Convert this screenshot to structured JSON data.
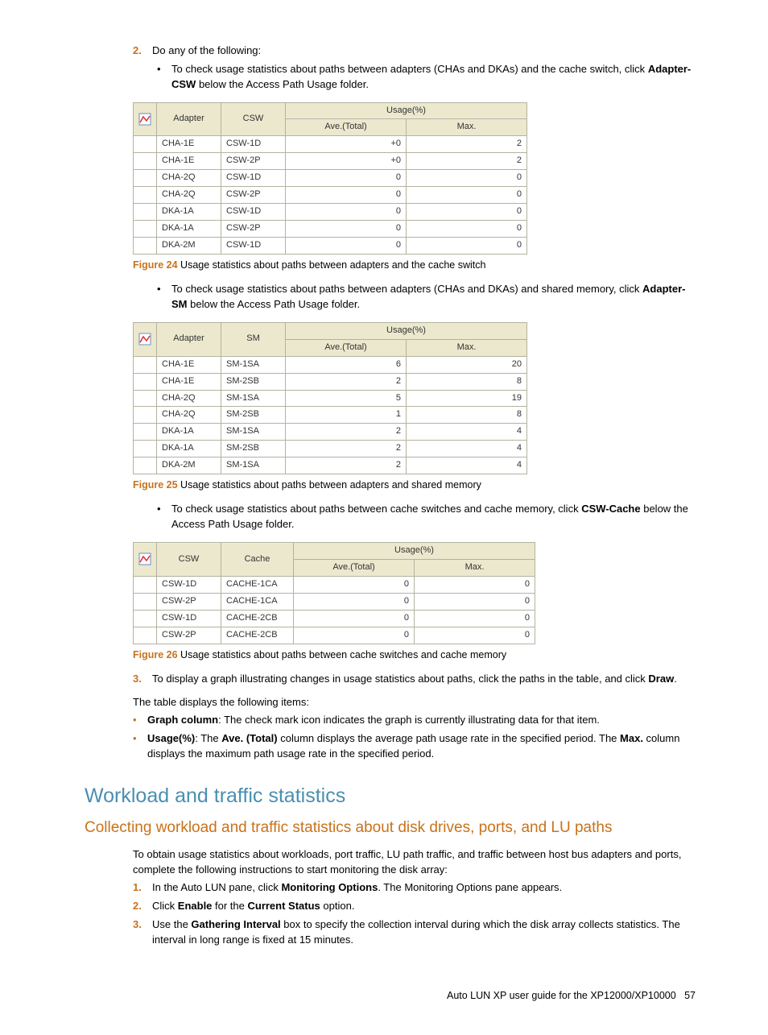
{
  "step2": {
    "num": "2.",
    "text": "Do any of the following:"
  },
  "b1": {
    "pre": "To check usage statistics about paths between adapters (CHAs and DKAs) and the cache switch, click ",
    "bold": "Adapter-CSW",
    "post": " below the Access Path Usage folder."
  },
  "table1": {
    "headers": {
      "c1": "Adapter",
      "c2": "CSW",
      "usage": "Usage(%)",
      "ave": "Ave.(Total)",
      "max": "Max."
    },
    "rows": [
      {
        "a": "CHA-1E",
        "b": "CSW-1D",
        "ave": "+0",
        "max": "2"
      },
      {
        "a": "CHA-1E",
        "b": "CSW-2P",
        "ave": "+0",
        "max": "2"
      },
      {
        "a": "CHA-2Q",
        "b": "CSW-1D",
        "ave": "0",
        "max": "0"
      },
      {
        "a": "CHA-2Q",
        "b": "CSW-2P",
        "ave": "0",
        "max": "0"
      },
      {
        "a": "DKA-1A",
        "b": "CSW-1D",
        "ave": "0",
        "max": "0"
      },
      {
        "a": "DKA-1A",
        "b": "CSW-2P",
        "ave": "0",
        "max": "0"
      },
      {
        "a": "DKA-2M",
        "b": "CSW-1D",
        "ave": "0",
        "max": "0"
      }
    ]
  },
  "fig24": {
    "num": "Figure 24",
    "text": "  Usage statistics about paths between adapters and the cache switch"
  },
  "b2": {
    "pre": "To check usage statistics about paths between adapters (CHAs and DKAs) and shared memory, click ",
    "bold": "Adapter-SM",
    "post": " below the Access Path Usage folder."
  },
  "table2": {
    "headers": {
      "c1": "Adapter",
      "c2": "SM",
      "usage": "Usage(%)",
      "ave": "Ave.(Total)",
      "max": "Max."
    },
    "rows": [
      {
        "a": "CHA-1E",
        "b": "SM-1SA",
        "ave": "6",
        "max": "20"
      },
      {
        "a": "CHA-1E",
        "b": "SM-2SB",
        "ave": "2",
        "max": "8"
      },
      {
        "a": "CHA-2Q",
        "b": "SM-1SA",
        "ave": "5",
        "max": "19"
      },
      {
        "a": "CHA-2Q",
        "b": "SM-2SB",
        "ave": "1",
        "max": "8"
      },
      {
        "a": "DKA-1A",
        "b": "SM-1SA",
        "ave": "2",
        "max": "4"
      },
      {
        "a": "DKA-1A",
        "b": "SM-2SB",
        "ave": "2",
        "max": "4"
      },
      {
        "a": "DKA-2M",
        "b": "SM-1SA",
        "ave": "2",
        "max": "4"
      }
    ]
  },
  "fig25": {
    "num": "Figure 25",
    "text": "  Usage statistics about paths between adapters and shared memory"
  },
  "b3": {
    "pre": "To check usage statistics about paths between cache switches and cache memory, click ",
    "bold": "CSW-Cache",
    "post": " below the Access Path Usage folder."
  },
  "table3": {
    "headers": {
      "c1": "CSW",
      "c2": "Cache",
      "usage": "Usage(%)",
      "ave": "Ave.(Total)",
      "max": "Max."
    },
    "rows": [
      {
        "a": "CSW-1D",
        "b": "CACHE-1CA",
        "ave": "0",
        "max": "0"
      },
      {
        "a": "CSW-2P",
        "b": "CACHE-1CA",
        "ave": "0",
        "max": "0"
      },
      {
        "a": "CSW-1D",
        "b": "CACHE-2CB",
        "ave": "0",
        "max": "0"
      },
      {
        "a": "CSW-2P",
        "b": "CACHE-2CB",
        "ave": "0",
        "max": "0"
      }
    ]
  },
  "fig26": {
    "num": "Figure 26",
    "text": "  Usage statistics about paths between cache switches and cache memory"
  },
  "step3": {
    "num": "3.",
    "pre": "To display a graph illustrating changes in usage statistics about paths, click the paths in the table, and click ",
    "bold": "Draw",
    "post": "."
  },
  "tabledisplays": "The table displays the following items:",
  "gb1": {
    "b1": "Graph column",
    "post": ": The check mark icon indicates the graph is currently illustrating data for that item."
  },
  "gb2": {
    "b1": "Usage(%)",
    "mid1": ": The ",
    "b2": "Ave. (Total)",
    "mid2": " column displays the average path usage rate in the specified period. The ",
    "b3": "Max.",
    "post": " column displays the maximum path usage rate in the specified period."
  },
  "h1": "Workload and traffic statistics",
  "h2": "Collecting workload and traffic statistics about disk drives, ports, and LU paths",
  "intro": "To obtain usage statistics about workloads, port traffic, LU path traffic, and traffic between host bus adapters and ports, complete the following instructions to start monitoring the disk array:",
  "s1": {
    "num": "1.",
    "pre": "In the Auto LUN pane, click ",
    "bold": "Monitoring Options",
    "post": ". The Monitoring Options pane appears."
  },
  "s2": {
    "num": "2.",
    "pre": "Click ",
    "bold1": "Enable",
    "mid": " for the ",
    "bold2": "Current Status",
    "post": " option."
  },
  "s3": {
    "num": "3.",
    "pre": "Use the ",
    "bold": "Gathering Interval",
    "post": " box to specify the collection interval during which the disk array collects statistics. The interval in long range is fixed at 15 minutes."
  },
  "footer": {
    "text": "Auto LUN XP user guide for the XP12000/XP10000",
    "page": "57"
  }
}
